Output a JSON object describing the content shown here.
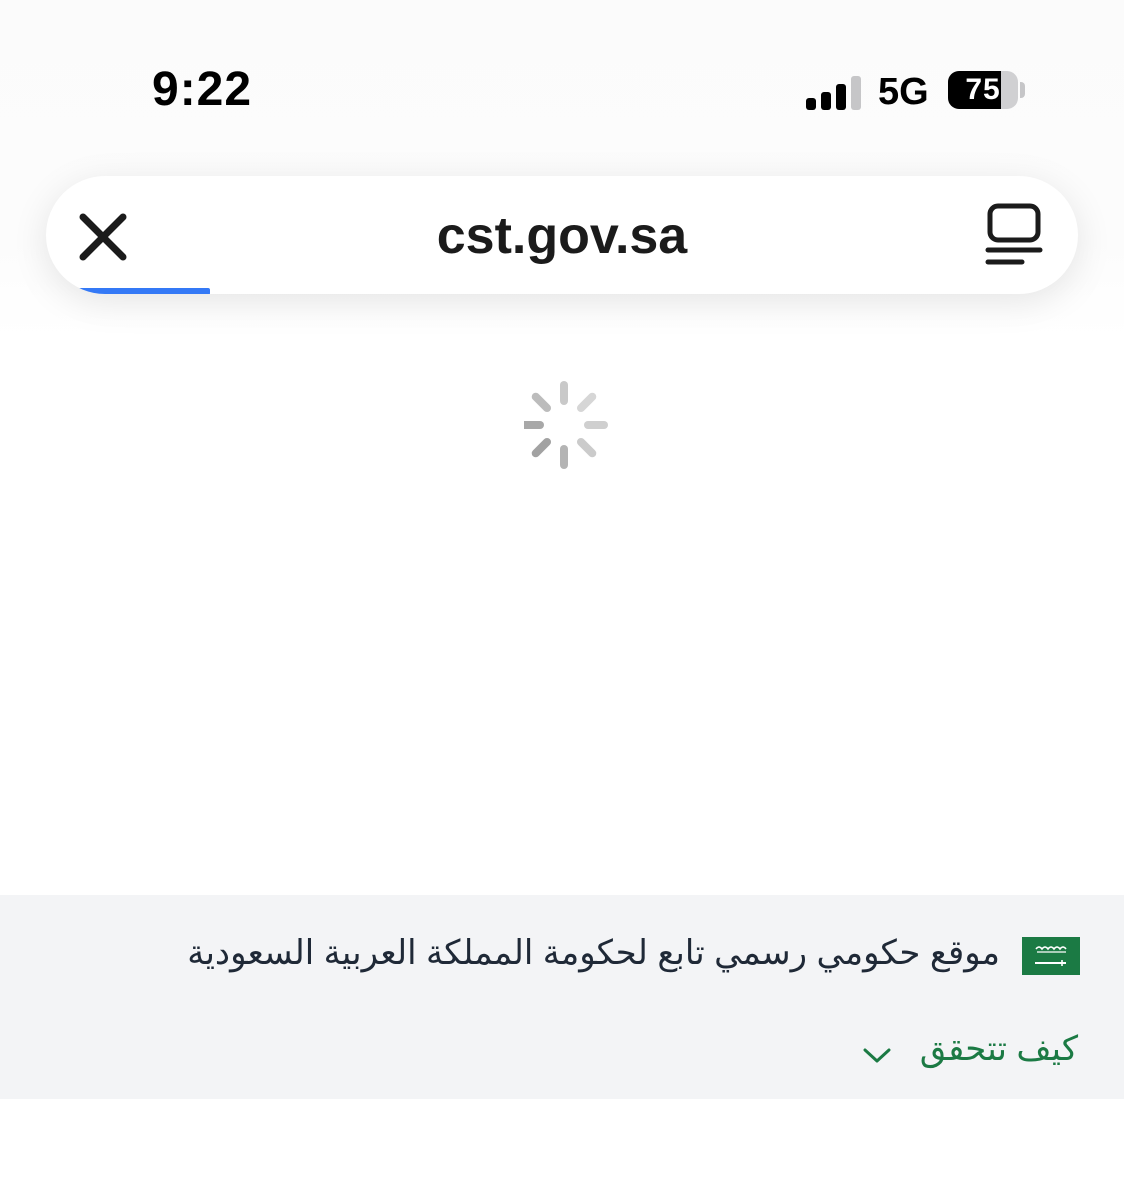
{
  "status_bar": {
    "time": "9:22",
    "network": "5G",
    "battery_percent": 75,
    "battery_text": "75",
    "signal_bars_active": 3,
    "signal_bars_total": 4,
    "icons": [
      "signal-icon",
      "battery-icon"
    ]
  },
  "address_bar": {
    "url": "cst.gov.sa",
    "loading_progress": 0.13,
    "left_icon": "close-icon",
    "right_icon": "reader-mode-icon",
    "progress_color": "#3479f6"
  },
  "page": {
    "state": "loading",
    "spinner_icon": "loading-spinner-icon"
  },
  "gov_banner": {
    "flag_icon": "saudi-flag-icon",
    "text": "موقع حكومي رسمي تابع لحكومة المملكة العربية السعودية",
    "link_text": "كيف تتحقق",
    "link_icon": "chevron-down-icon",
    "link_color": "#1b7a44",
    "background": "#f3f4f6"
  }
}
